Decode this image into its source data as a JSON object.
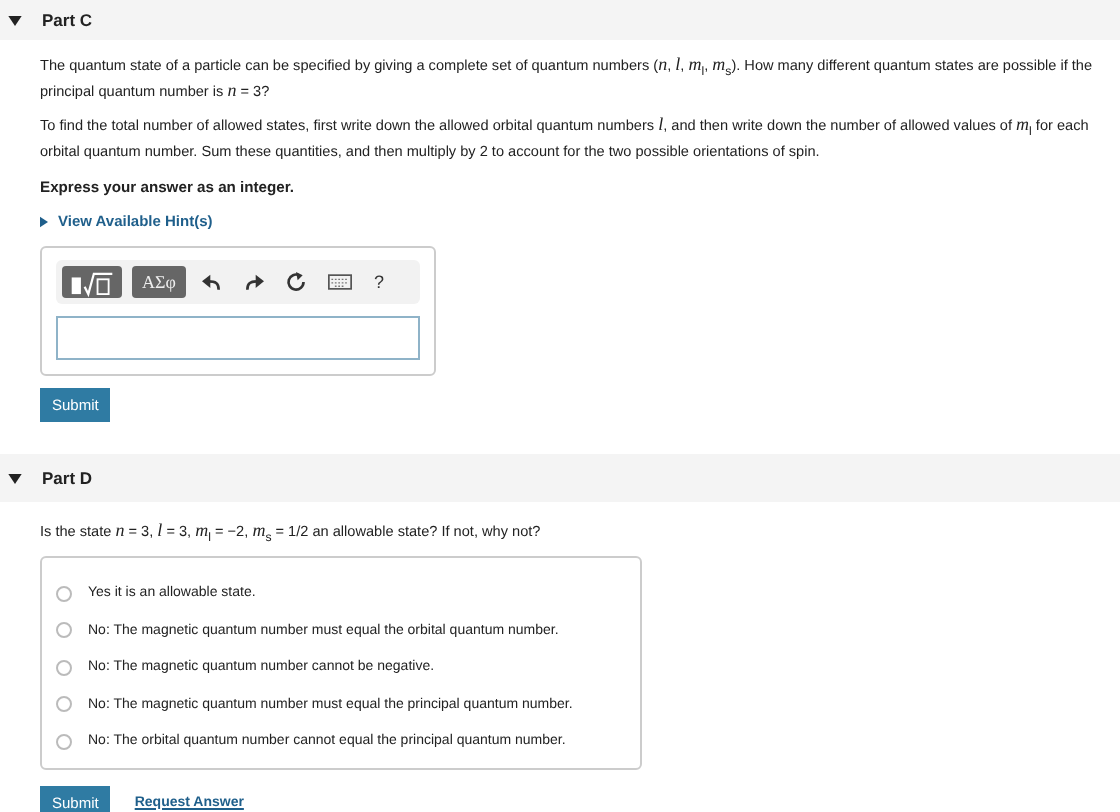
{
  "parts": [
    {
      "kind": "answer",
      "title": "Part C",
      "expanded": true,
      "paragraphs": [
        "The quantum state of a particle can be specified by giving a complete set of quantum numbers (*n*, *l*, *m*$_{l}$, *m*$_{s}$). How many different quantum states are possible if the principal quantum number is *n* = 3?",
        "To find the total number of allowed states, first write down the allowed orbital quantum numbers *l*, and then write down the number of allowed values of *m*$_{l}$ for each orbital quantum number. Sum these quantities, and then multiply by 2 to account for the two possible orientations of spin."
      ],
      "instruction": "Express your answer as an integer.",
      "hint": {
        "label": "View Available Hint(s)",
        "expanded": false
      },
      "toolbar": {
        "symbols_label": "ΑΣφ",
        "help": "?"
      },
      "submit": "Submit"
    },
    {
      "kind": "choice",
      "title": "Part D",
      "expanded": true,
      "question": "Is the state *n* = 3, *l* = 3, *m*$_{l}$ = −2, *m*$_{s}$ = 1/2 an allowable state? If not, why not?",
      "options": [
        {
          "label": "Yes it is an allowable state.",
          "selected": false
        },
        {
          "label": "No: The magnetic quantum number must equal the orbital quantum number.",
          "selected": false
        },
        {
          "label": "No: The magnetic quantum number cannot be negative.",
          "selected": false
        },
        {
          "label": "No: The magnetic quantum number must equal the principal quantum number.",
          "selected": false
        },
        {
          "label": "No: The orbital quantum number cannot equal the principal quantum number.",
          "selected": false
        }
      ],
      "submit": "Submit",
      "request": "Request Answer"
    }
  ]
}
